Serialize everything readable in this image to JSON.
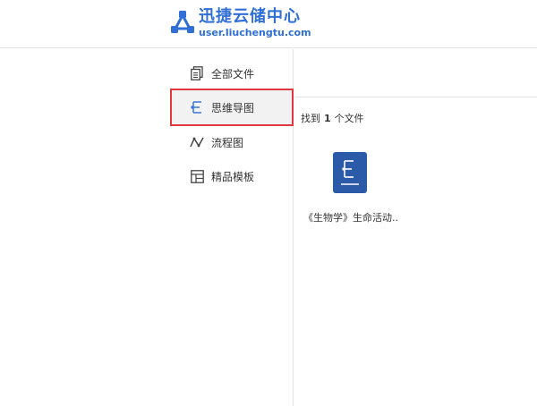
{
  "header": {
    "brand_name": "迅捷云储中心",
    "brand_url": "user.liuchengtu.com",
    "logo_icon": "share-nodes-icon"
  },
  "sidebar": {
    "items": [
      {
        "label": "全部文件",
        "icon": "documents-icon",
        "active": false
      },
      {
        "label": "思维导图",
        "icon": "mindmap-icon",
        "active": true
      },
      {
        "label": "流程图",
        "icon": "flowline-icon",
        "active": false
      },
      {
        "label": "精品模板",
        "icon": "template-icon",
        "active": false
      }
    ]
  },
  "main": {
    "result_prefix": "找到",
    "result_count": "1",
    "result_suffix": "个文件",
    "files": [
      {
        "name": "《生物学》生命活动..",
        "icon": "mindmap-file-icon"
      }
    ]
  },
  "colors": {
    "brand": "#2f6fd6",
    "highlight_border": "#e0393e",
    "file_icon": "#2b5aa8"
  }
}
